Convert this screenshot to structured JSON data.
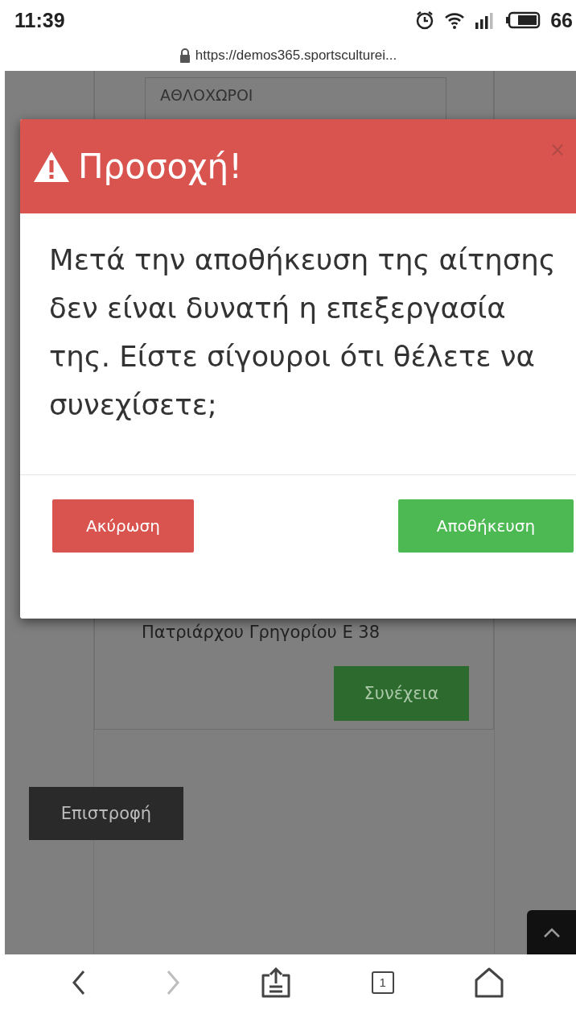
{
  "status_bar": {
    "time": "11:39",
    "battery": "66"
  },
  "address_bar": {
    "url": "https://demos365.sportsculturei..."
  },
  "page": {
    "section_label": "ΑΘΛΟΧΩΡΟΙ",
    "address": "Πατριάρχου Γρηγορίου Ε 38",
    "continue_button": "Συνέχεια",
    "back_button": "Επιστροφή"
  },
  "modal": {
    "title": "Προσοχή!",
    "close": "×",
    "message": "Μετά την αποθήκευση της αίτησης δεν είναι δυνατή η επεξεργασία της. Είστε σίγουροι ότι θέλετε να συνεχίσετε;",
    "buttons": [
      {
        "label": "Ακύρωση",
        "kind": "danger"
      },
      {
        "label": "Αποθήκευση",
        "kind": "success"
      }
    ]
  },
  "browser_toolbar": {
    "tab_count": "1",
    "forward_disabled": true
  }
}
